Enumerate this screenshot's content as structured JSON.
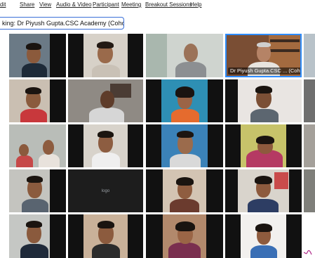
{
  "menu": {
    "items": [
      "dit",
      "Share",
      "View",
      "Audio & Video",
      "Participant",
      "Meeting",
      "Breakout Sessions",
      "Help"
    ]
  },
  "speaking": {
    "text": "king: Dr Piyush Gupta.CSC Academy (Cohost)"
  },
  "active_tile": {
    "name": "Dr Piyush Gupta.CSC ... (Cohost)"
  },
  "center_tile": {
    "logo_text": "logo"
  },
  "colors": {
    "accent": "#2d8cff",
    "tile_dark": "#1a1a1a",
    "speaking_border": "#3a6fd8"
  }
}
